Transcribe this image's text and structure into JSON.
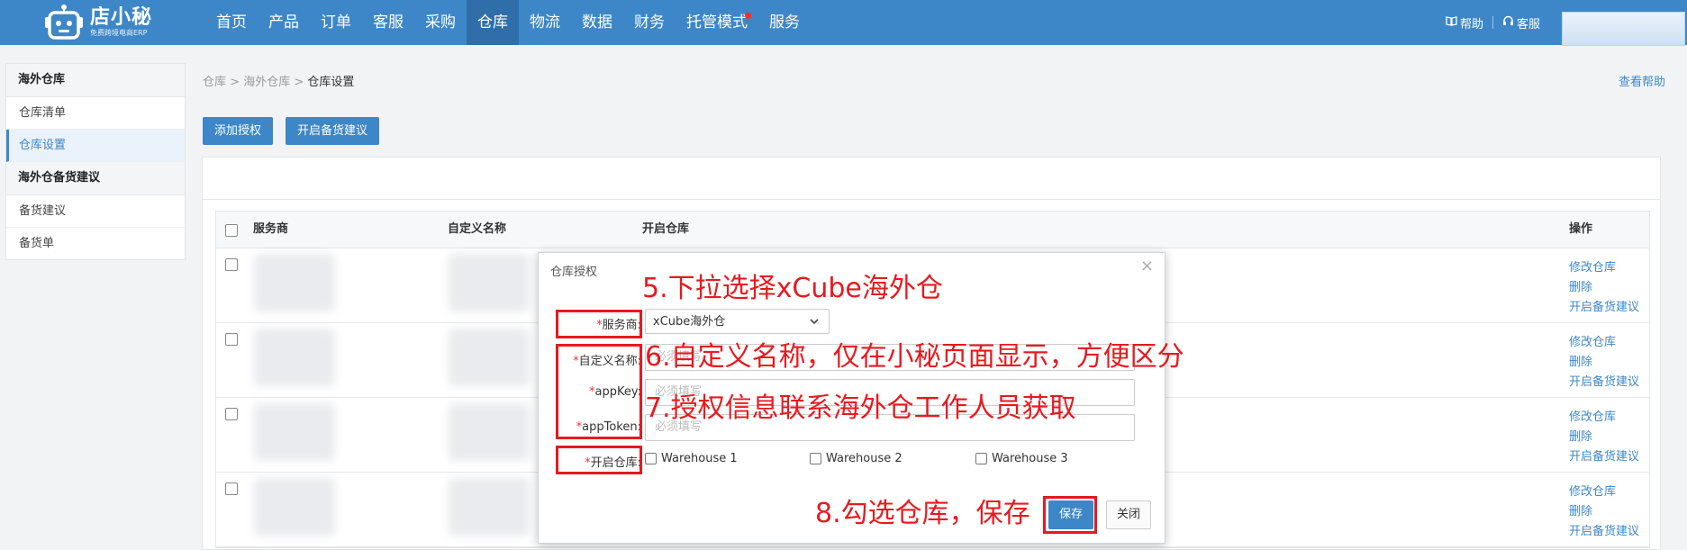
{
  "app": {
    "brand_name": "店小秘",
    "brand_sub": "免费跨境电商ERP"
  },
  "nav": [
    {
      "label": "首页"
    },
    {
      "label": "产品"
    },
    {
      "label": "订单"
    },
    {
      "label": "客服"
    },
    {
      "label": "采购"
    },
    {
      "label": "仓库",
      "active": true
    },
    {
      "label": "物流"
    },
    {
      "label": "数据"
    },
    {
      "label": "财务"
    },
    {
      "label": "托管模式",
      "dot": true
    },
    {
      "label": "服务"
    }
  ],
  "top_right": {
    "help": "帮助",
    "service": "客服"
  },
  "sidebar": {
    "group1": "海外仓库",
    "group1_items": [
      "仓库清单",
      "仓库设置"
    ],
    "group2": "海外仓备货建议",
    "group2_items": [
      "备货建议",
      "备货单"
    ]
  },
  "breadcrumb": {
    "items": [
      "仓库",
      "海外仓库",
      "仓库设置"
    ],
    "sep": ">"
  },
  "help_link": "查看帮助",
  "toolbar": {
    "add_auth": "添加授权",
    "enable_stock": "开启备货建议"
  },
  "table": {
    "headers": [
      "服务商",
      "自定义名称",
      "开启仓库",
      "操作"
    ],
    "row_ops": [
      "修改仓库",
      "删除",
      "开启备货建议"
    ],
    "row_count": 4
  },
  "modal": {
    "title": "仓库授权",
    "close": "×",
    "req": "*",
    "labels": {
      "provider": "服务商:",
      "custom_name": "自定义名称:",
      "app_key": "appKey:",
      "app_token": "appToken:",
      "warehouses": "开启仓库:"
    },
    "provider_value": "xCube海外仓",
    "placeholder": "必须填写",
    "warehouses": [
      "Warehouse 1",
      "Warehouse 2",
      "Warehouse 3"
    ],
    "save": "保存",
    "cancel": "关闭"
  },
  "annotations": {
    "step5": "5.下拉选择xCube海外仓",
    "step6": "6.自定义名称，仅在小秘页面显示，方便区分",
    "step7": "7.授权信息联系海外仓工作人员获取",
    "step8": "8.勾选仓库，保存"
  },
  "colors": {
    "header_blue": "#3d87c8",
    "annotation_red": "#e8191f"
  }
}
